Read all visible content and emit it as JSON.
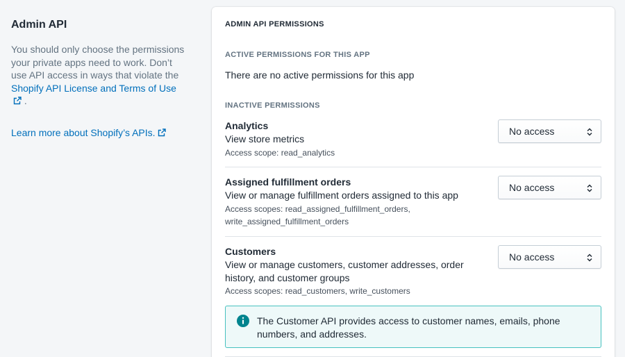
{
  "aside": {
    "title": "Admin API",
    "text_before_link": "You should only choose the permissions your private apps need to work. Don’t use API access in ways that violate the ",
    "license_link": "Shopify API License and Terms of Use",
    "text_after_link": ".",
    "learn_link": "Learn more about Shopify’s APIs."
  },
  "card": {
    "title": "ADMIN API PERMISSIONS",
    "active_heading": "ACTIVE PERMISSIONS FOR THIS APP",
    "active_empty": "There are no active permissions for this app",
    "inactive_heading": "INACTIVE PERMISSIONS",
    "permissions": [
      {
        "name": "Analytics",
        "description": "View store metrics",
        "scope": "Access scope: read_analytics",
        "access": "No access"
      },
      {
        "name": "Assigned fulfillment orders",
        "description": "View or manage fulfillment orders assigned to this app",
        "scope": "Access scopes: read_assigned_fulfillment_orders, write_assigned_fulfillment_orders",
        "access": "No access"
      },
      {
        "name": "Customers",
        "description": "View or manage customers, customer addresses, order history, and customer groups",
        "scope": "Access scopes: read_customers, write_customers",
        "access": "No access"
      }
    ],
    "banner": "The Customer API provides access to customer names, emails, phone numbers, and addresses."
  },
  "colors": {
    "link": "#006fbb",
    "banner_border": "#47c1bf",
    "banner_bg": "#eef9f9",
    "info_icon": "#00848e"
  }
}
